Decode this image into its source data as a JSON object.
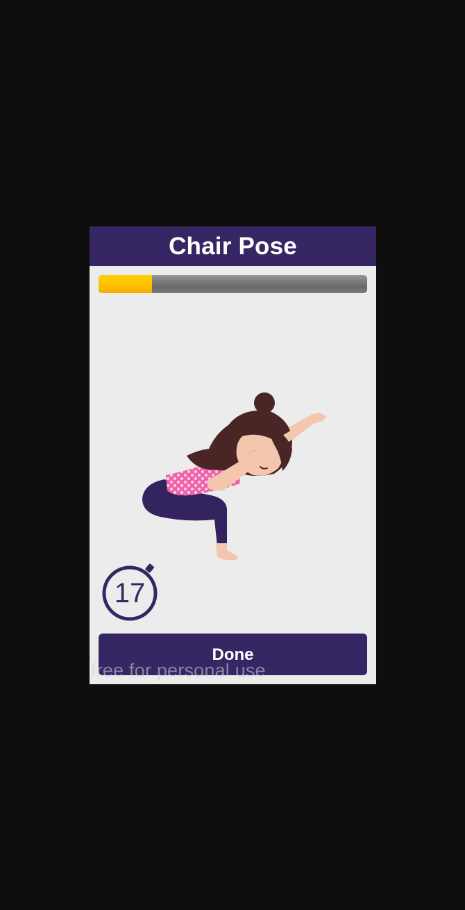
{
  "title": "Chair Pose",
  "progress": {
    "fraction": 0.2,
    "fill_color": "#ffc000",
    "track_color": "#7a7a7a"
  },
  "illustration": {
    "icon": "girl-chair-pose-illustration"
  },
  "timer": {
    "value": "17",
    "icon": "stopwatch-icon"
  },
  "done_button": {
    "label": "Done"
  },
  "watermark": "free for personal use",
  "colors": {
    "accent": "#372664",
    "dialog_background": "#ebeceb",
    "screen_background": "#0e0e0e"
  }
}
